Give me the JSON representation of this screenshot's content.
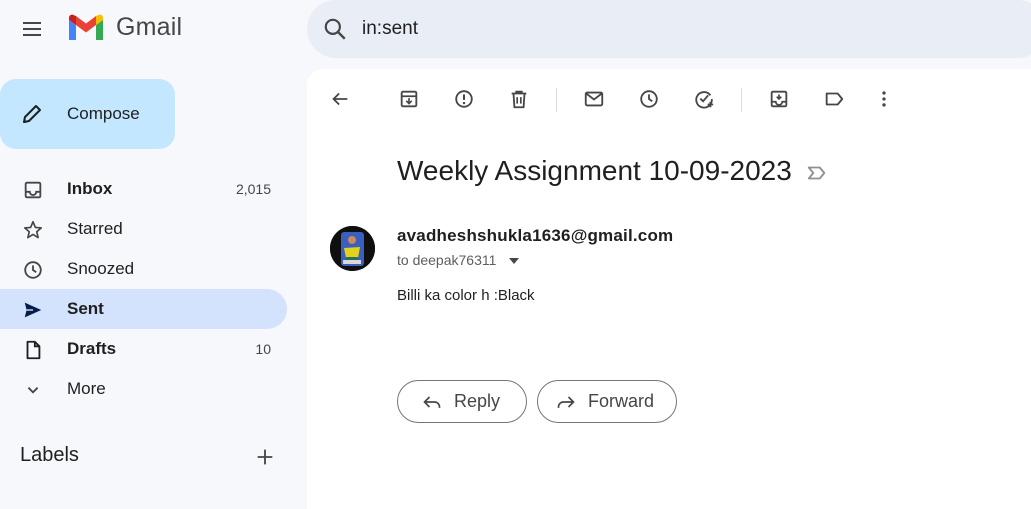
{
  "app": {
    "name": "Gmail"
  },
  "search": {
    "query": "in:sent"
  },
  "compose": {
    "label": "Compose"
  },
  "sidebar": {
    "items": [
      {
        "label": "Inbox",
        "count": "2,015",
        "icon": "inbox-icon",
        "bold": true
      },
      {
        "label": "Starred",
        "count": "",
        "icon": "star-icon",
        "bold": false
      },
      {
        "label": "Snoozed",
        "count": "",
        "icon": "clock-icon",
        "bold": false
      },
      {
        "label": "Sent",
        "count": "",
        "icon": "send-icon",
        "bold": true,
        "active": true
      },
      {
        "label": "Drafts",
        "count": "10",
        "icon": "draft-icon",
        "bold": true
      },
      {
        "label": "More",
        "count": "",
        "icon": "chevron-down-icon",
        "bold": false
      }
    ],
    "labels_title": "Labels"
  },
  "toolbar": {
    "icons": [
      "back-icon",
      "archive-icon",
      "report-spam-icon",
      "delete-icon",
      "mark-unread-icon",
      "snooze-icon",
      "add-task-icon",
      "move-to-icon",
      "label-icon",
      "more-icon"
    ]
  },
  "email": {
    "subject": "Weekly Assignment 10-09-2023",
    "sender": "avadheshshukla1636@gmail.com",
    "to": "to deepak76311",
    "body": "Billi ka color h :Black"
  },
  "actions": {
    "reply": "Reply",
    "forward": "Forward"
  },
  "colors": {
    "active_nav": "#d3e3fd",
    "compose_bg": "#c2e7ff",
    "search_bg": "#e9eef6",
    "background": "#f6f8fc"
  }
}
